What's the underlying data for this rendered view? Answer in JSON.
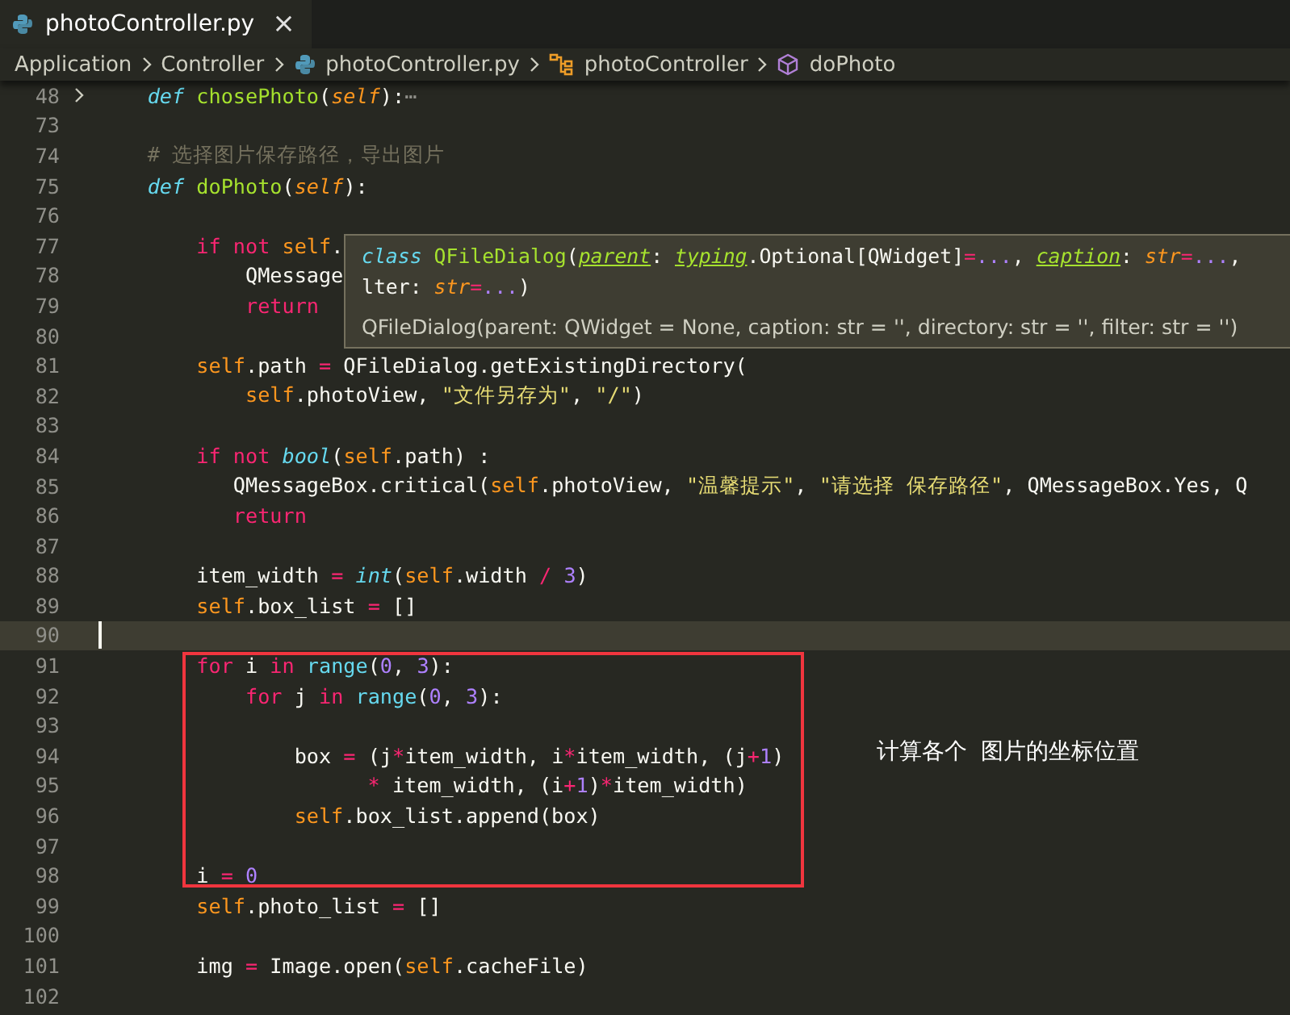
{
  "tab": {
    "label": "photoController.py",
    "close": "×"
  },
  "breadcrumb": [
    {
      "label": "Application",
      "kind": "folder"
    },
    {
      "label": "Controller",
      "kind": "folder"
    },
    {
      "label": "photoController.py",
      "kind": "python"
    },
    {
      "label": "photoController",
      "kind": "class"
    },
    {
      "label": "doPhoto",
      "kind": "method"
    }
  ],
  "lines": [
    {
      "number": "48",
      "kind": "folded",
      "tokens": [
        {
          "text": "    def",
          "kind": "kw"
        },
        {
          "text": " chosePhoto",
          "kind": "fn"
        },
        {
          "text": "(",
          "kind": "plain"
        },
        {
          "text": "self",
          "kind": "param"
        },
        {
          "text": "):",
          "kind": "plain"
        },
        {
          "text": "⋯",
          "kind": "fold"
        }
      ]
    },
    {
      "number": "73",
      "kind": "normal"
    },
    {
      "number": "74",
      "kind": "normal",
      "tokens": [
        {
          "text": "    # 选择图片保存路径，导出图片",
          "kind": "comment"
        }
      ]
    },
    {
      "number": "75",
      "kind": "normal",
      "tokens": [
        {
          "text": "    def",
          "kind": "kw"
        },
        {
          "text": " doPhoto",
          "kind": "fn"
        },
        {
          "text": "(",
          "kind": "plain"
        },
        {
          "text": "self",
          "kind": "param"
        },
        {
          "text": "):",
          "kind": "plain"
        }
      ]
    },
    {
      "number": "76",
      "kind": "normal"
    },
    {
      "number": "77",
      "kind": "normal",
      "tokens": [
        {
          "text": "        if",
          "kind": "ctrl"
        },
        {
          "text": " not",
          "kind": "ctrl"
        },
        {
          "text": " self",
          "kind": "self"
        },
        {
          "text": ".",
          "kind": "plain"
        }
      ]
    },
    {
      "number": "78",
      "kind": "normal",
      "tokens": [
        {
          "text": "            QMessage",
          "kind": "plain"
        }
      ]
    },
    {
      "number": "79",
      "kind": "normal",
      "tokens": [
        {
          "text": "            return",
          "kind": "ctrl"
        }
      ]
    },
    {
      "number": "80",
      "kind": "normal"
    },
    {
      "number": "81",
      "kind": "normal",
      "tokens": [
        {
          "text": "        self",
          "kind": "self"
        },
        {
          "text": ".path ",
          "kind": "plain"
        },
        {
          "text": "=",
          "kind": "op"
        },
        {
          "text": " QFileDialog.getExistingDirectory(",
          "kind": "plain"
        }
      ]
    },
    {
      "number": "82",
      "kind": "normal",
      "tokens": [
        {
          "text": "            self",
          "kind": "self"
        },
        {
          "text": ".photoView, ",
          "kind": "plain"
        },
        {
          "text": "\"文件另存为\"",
          "kind": "str"
        },
        {
          "text": ", ",
          "kind": "plain"
        },
        {
          "text": "\"/\"",
          "kind": "str"
        },
        {
          "text": ")",
          "kind": "plain"
        }
      ]
    },
    {
      "number": "83",
      "kind": "normal"
    },
    {
      "number": "84",
      "kind": "normal",
      "tokens": [
        {
          "text": "        if",
          "kind": "ctrl"
        },
        {
          "text": " not",
          "kind": "ctrl"
        },
        {
          "text": " bool",
          "kind": "kw"
        },
        {
          "text": "(",
          "kind": "plain"
        },
        {
          "text": "self",
          "kind": "self"
        },
        {
          "text": ".path) :",
          "kind": "plain"
        }
      ]
    },
    {
      "number": "85",
      "kind": "normal",
      "tokens": [
        {
          "text": "           QMessageBox.critical(",
          "kind": "plain"
        },
        {
          "text": "self",
          "kind": "self"
        },
        {
          "text": ".photoView, ",
          "kind": "plain"
        },
        {
          "text": "\"温馨提示\"",
          "kind": "str"
        },
        {
          "text": ", ",
          "kind": "plain"
        },
        {
          "text": "\"请选择 保存路径\"",
          "kind": "str"
        },
        {
          "text": ", QMessageBox.Yes, Q",
          "kind": "plain"
        }
      ]
    },
    {
      "number": "86",
      "kind": "normal",
      "tokens": [
        {
          "text": "           return",
          "kind": "ctrl"
        }
      ]
    },
    {
      "number": "87",
      "kind": "normal"
    },
    {
      "number": "88",
      "kind": "normal",
      "tokens": [
        {
          "text": "        item_width ",
          "kind": "plain"
        },
        {
          "text": "=",
          "kind": "op"
        },
        {
          "text": " int",
          "kind": "kw"
        },
        {
          "text": "(",
          "kind": "plain"
        },
        {
          "text": "self",
          "kind": "self"
        },
        {
          "text": ".width ",
          "kind": "plain"
        },
        {
          "text": "/",
          "kind": "op"
        },
        {
          "text": " 3",
          "kind": "num"
        },
        {
          "text": ")",
          "kind": "plain"
        }
      ]
    },
    {
      "number": "89",
      "kind": "normal",
      "tokens": [
        {
          "text": "        self",
          "kind": "self"
        },
        {
          "text": ".box_list ",
          "kind": "plain"
        },
        {
          "text": "=",
          "kind": "op"
        },
        {
          "text": " []",
          "kind": "plain"
        }
      ]
    },
    {
      "number": "90",
      "kind": "current"
    },
    {
      "number": "91",
      "kind": "normal",
      "tokens": [
        {
          "text": "        for",
          "kind": "ctrl"
        },
        {
          "text": " i ",
          "kind": "plain"
        },
        {
          "text": "in",
          "kind": "ctrl"
        },
        {
          "text": " range",
          "kind": "builtin"
        },
        {
          "text": "(",
          "kind": "plain"
        },
        {
          "text": "0",
          "kind": "num"
        },
        {
          "text": ", ",
          "kind": "plain"
        },
        {
          "text": "3",
          "kind": "num"
        },
        {
          "text": "):",
          "kind": "plain"
        }
      ]
    },
    {
      "number": "92",
      "kind": "normal",
      "tokens": [
        {
          "text": "            for",
          "kind": "ctrl"
        },
        {
          "text": " j ",
          "kind": "plain"
        },
        {
          "text": "in",
          "kind": "ctrl"
        },
        {
          "text": " range",
          "kind": "builtin"
        },
        {
          "text": "(",
          "kind": "plain"
        },
        {
          "text": "0",
          "kind": "num"
        },
        {
          "text": ", ",
          "kind": "plain"
        },
        {
          "text": "3",
          "kind": "num"
        },
        {
          "text": "):",
          "kind": "plain"
        }
      ]
    },
    {
      "number": "93",
      "kind": "normal"
    },
    {
      "number": "94",
      "kind": "normal",
      "tokens": [
        {
          "text": "                box ",
          "kind": "plain"
        },
        {
          "text": "=",
          "kind": "op"
        },
        {
          "text": " (j",
          "kind": "plain"
        },
        {
          "text": "*",
          "kind": "op"
        },
        {
          "text": "item_width, i",
          "kind": "plain"
        },
        {
          "text": "*",
          "kind": "op"
        },
        {
          "text": "item_width, (j",
          "kind": "plain"
        },
        {
          "text": "+",
          "kind": "op"
        },
        {
          "text": "1",
          "kind": "num"
        },
        {
          "text": ")",
          "kind": "plain"
        }
      ]
    },
    {
      "number": "95",
      "kind": "normal",
      "tokens": [
        {
          "text": "                      *",
          "kind": "op"
        },
        {
          "text": " item_width, (i",
          "kind": "plain"
        },
        {
          "text": "+",
          "kind": "op"
        },
        {
          "text": "1",
          "kind": "num"
        },
        {
          "text": ")",
          "kind": "plain"
        },
        {
          "text": "*",
          "kind": "op"
        },
        {
          "text": "item_width)",
          "kind": "plain"
        }
      ]
    },
    {
      "number": "96",
      "kind": "normal",
      "tokens": [
        {
          "text": "                self",
          "kind": "self"
        },
        {
          "text": ".box_list.append(box)",
          "kind": "plain"
        }
      ]
    },
    {
      "number": "97",
      "kind": "normal"
    },
    {
      "number": "98",
      "kind": "normal",
      "tokens": [
        {
          "text": "        i ",
          "kind": "plain"
        },
        {
          "text": "=",
          "kind": "op"
        },
        {
          "text": " 0",
          "kind": "num"
        }
      ]
    },
    {
      "number": "99",
      "kind": "normal",
      "tokens": [
        {
          "text": "        self",
          "kind": "self"
        },
        {
          "text": ".photo_list ",
          "kind": "plain"
        },
        {
          "text": "=",
          "kind": "op"
        },
        {
          "text": " []",
          "kind": "plain"
        }
      ]
    },
    {
      "number": "100",
      "kind": "normal"
    },
    {
      "number": "101",
      "kind": "normal",
      "tokens": [
        {
          "text": "        img ",
          "kind": "plain"
        },
        {
          "text": "=",
          "kind": "op"
        },
        {
          "text": " Image.open(",
          "kind": "plain"
        },
        {
          "text": "self",
          "kind": "self"
        },
        {
          "text": ".cacheFile)",
          "kind": "plain"
        }
      ]
    },
    {
      "number": "102",
      "kind": "normal"
    }
  ],
  "tooltip": {
    "signature": [
      [
        {
          "text": "class",
          "kind": "kw"
        },
        {
          "text": " QFileDialog",
          "kind": "signame"
        },
        {
          "text": "(",
          "kind": "plain"
        },
        {
          "text": "parent",
          "kind": "sigparam"
        },
        {
          "text": ": ",
          "kind": "plain"
        },
        {
          "text": "typing",
          "kind": "sigparam"
        },
        {
          "text": ".Optional[QWidget]",
          "kind": "plain"
        },
        {
          "text": "=",
          "kind": "op"
        },
        {
          "text": "...",
          "kind": "num"
        },
        {
          "text": ", ",
          "kind": "plain"
        },
        {
          "text": "caption",
          "kind": "sigparam"
        },
        {
          "text": ": ",
          "kind": "plain"
        },
        {
          "text": "str",
          "kind": "param"
        },
        {
          "text": "=",
          "kind": "op"
        },
        {
          "text": "...",
          "kind": "num"
        },
        {
          "text": ",",
          "kind": "plain"
        }
      ],
      [
        {
          "text": "lter: ",
          "kind": "plain"
        },
        {
          "text": "str",
          "kind": "param"
        },
        {
          "text": "=",
          "kind": "op"
        },
        {
          "text": "...",
          "kind": "num"
        },
        {
          "text": ")",
          "kind": "plain"
        }
      ]
    ],
    "doc": "QFileDialog(parent: QWidget = None, caption: str = '', directory: str = '', filter: str = '')"
  },
  "annotation": {
    "text": "计算各个 图片的坐标位置"
  }
}
